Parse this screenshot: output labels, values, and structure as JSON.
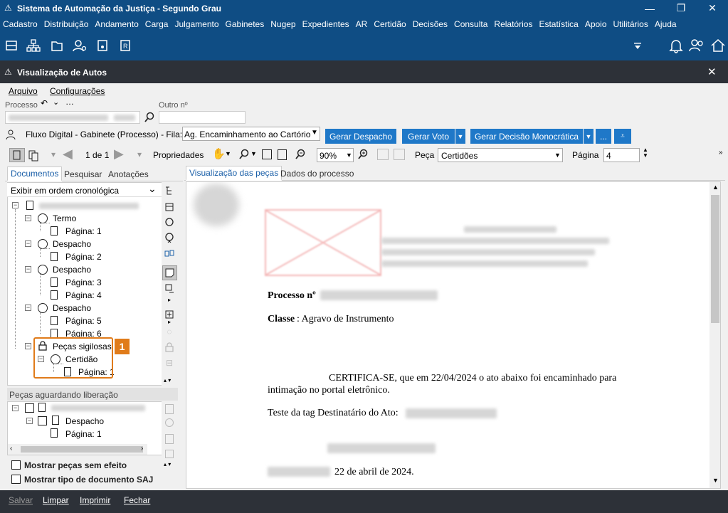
{
  "window": {
    "title": "Sistema de Automação da Justiça - Segundo Grau",
    "minimize": "—",
    "restore": "❐",
    "close": "✕"
  },
  "menu": [
    "Cadastro",
    "Distribuição",
    "Andamento",
    "Carga",
    "Julgamento",
    "Gabinetes",
    "Nugep",
    "Expedientes",
    "AR",
    "Certidão",
    "Decisões",
    "Consulta",
    "Relatórios",
    "Estatística",
    "Apoio",
    "Utilitários",
    "Ajuda"
  ],
  "subwindow": {
    "title": "Visualização de Autos",
    "close": "✕"
  },
  "submenu": {
    "arquivo": "Arquivo",
    "configuracoes": "Configurações"
  },
  "fields": {
    "processo_label": "Processo",
    "outro_label": "Outro nº"
  },
  "fluxo": {
    "label": "Fluxo Digital - Gabinete (Processo) - Fila:",
    "fila_value": "Ag. Encaminhamento ao Cartório",
    "gerar_despacho": "Gerar Despacho",
    "gerar_voto": "Gerar Voto",
    "gerar_decisao": "Gerar Decisão Monocrática",
    "more": "..."
  },
  "toolbar": {
    "page_counter": "1 de 1",
    "propriedades": "Propriedades",
    "zoom": "90%",
    "peca_label": "Peça",
    "peca_value": "Certidões",
    "pagina_label": "Página",
    "pagina_value": "4"
  },
  "left_tabs": {
    "documentos": "Documentos",
    "pesquisar": "Pesquisar",
    "anotacoes": "Anotações"
  },
  "order_select": "Exibir em ordem cronológica",
  "tree": {
    "termo": "Termo",
    "despacho1": "Despacho",
    "despacho2": "Despacho",
    "despacho3": "Despacho",
    "pages": [
      "Página: 1",
      "Página: 2",
      "Página: 3",
      "Página: 4",
      "Página: 5",
      "Página: 6"
    ],
    "sigilosas": "Peças sigilosas",
    "certidao": "Certidão",
    "cert_page": "Página: 1",
    "callout": "1"
  },
  "aguardando": {
    "header": "Peças aguardando liberação",
    "despacho": "Despacho",
    "page": "Página: 1"
  },
  "checks": {
    "sem_efeito": "Mostrar peças sem efeito",
    "tipo_saj": "Mostrar tipo de documento SAJ"
  },
  "right_tabs": {
    "visualizacao": "Visualização das peças",
    "dados": "Dados do processo"
  },
  "document": {
    "processo_label": "Processo nº",
    "classe_label": "Classe",
    "classe_value": ": Agravo de Instrumento",
    "certifica": "CERTIFICA-SE, que em 22/04/2024 o ato abaixo foi encaminhado para",
    "certifica2": "intimação no portal eletrônico.",
    "teste": "Teste da tag Destinatário do Ato:",
    "date": "22 de abril de 2024."
  },
  "bottom": {
    "salvar": "Salvar",
    "limpar": "Limpar",
    "imprimir": "Imprimir",
    "fechar": "Fechar"
  },
  "colors": {
    "titlebar": "#0f4d84",
    "subbar": "#2d3138",
    "button": "#1f78c8",
    "callout": "#e07b1a"
  }
}
